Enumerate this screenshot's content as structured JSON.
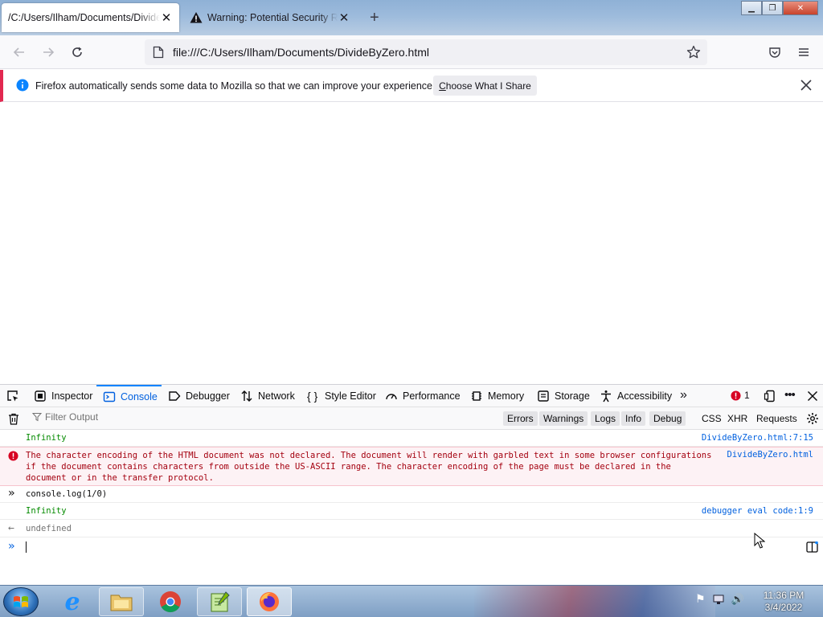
{
  "tabs": [
    {
      "title": "/C:/Users/Ilham/Documents/DivideByZero.html",
      "active": true
    },
    {
      "title": "Warning: Potential Security Risk Ahead",
      "active": false
    }
  ],
  "url": "file:///C:/Users/Ilham/Documents/DivideByZero.html",
  "notification": {
    "text": "Firefox automatically sends some data to Mozilla so that we can improve your experience.",
    "button": "Choose What I Share"
  },
  "devtools": {
    "tabs": [
      "Inspector",
      "Console",
      "Debugger",
      "Network",
      "Style Editor",
      "Performance",
      "Memory",
      "Storage",
      "Accessibility"
    ],
    "selected_tab": "Console",
    "error_count": "1",
    "filter_placeholder": "Filter Output",
    "filters": [
      "Errors",
      "Warnings",
      "Logs",
      "Info",
      "Debug"
    ],
    "extra_filters": [
      "CSS",
      "XHR",
      "Requests"
    ],
    "messages": [
      {
        "type": "log",
        "text": "Infinity",
        "source": "DivideByZero.html:7:15"
      },
      {
        "type": "error",
        "text": "The character encoding of the HTML document was not declared. The document will render with garbled text in some browser configurations if the document contains characters from outside the US-ASCII range. The character encoding of the page must be declared in the document or in the transfer protocol.",
        "source": "DivideByZero.html"
      },
      {
        "type": "input",
        "text": "console.log(1/0)"
      },
      {
        "type": "log",
        "text": "Infinity",
        "source": "debugger eval code:1:9"
      },
      {
        "type": "result",
        "text": "undefined"
      }
    ]
  },
  "taskbar": {
    "time": "11:36 PM",
    "date": "3/4/2022"
  },
  "colors": {
    "accent": "#0060df",
    "error_text": "#a4000f",
    "log_text": "#058b00"
  }
}
